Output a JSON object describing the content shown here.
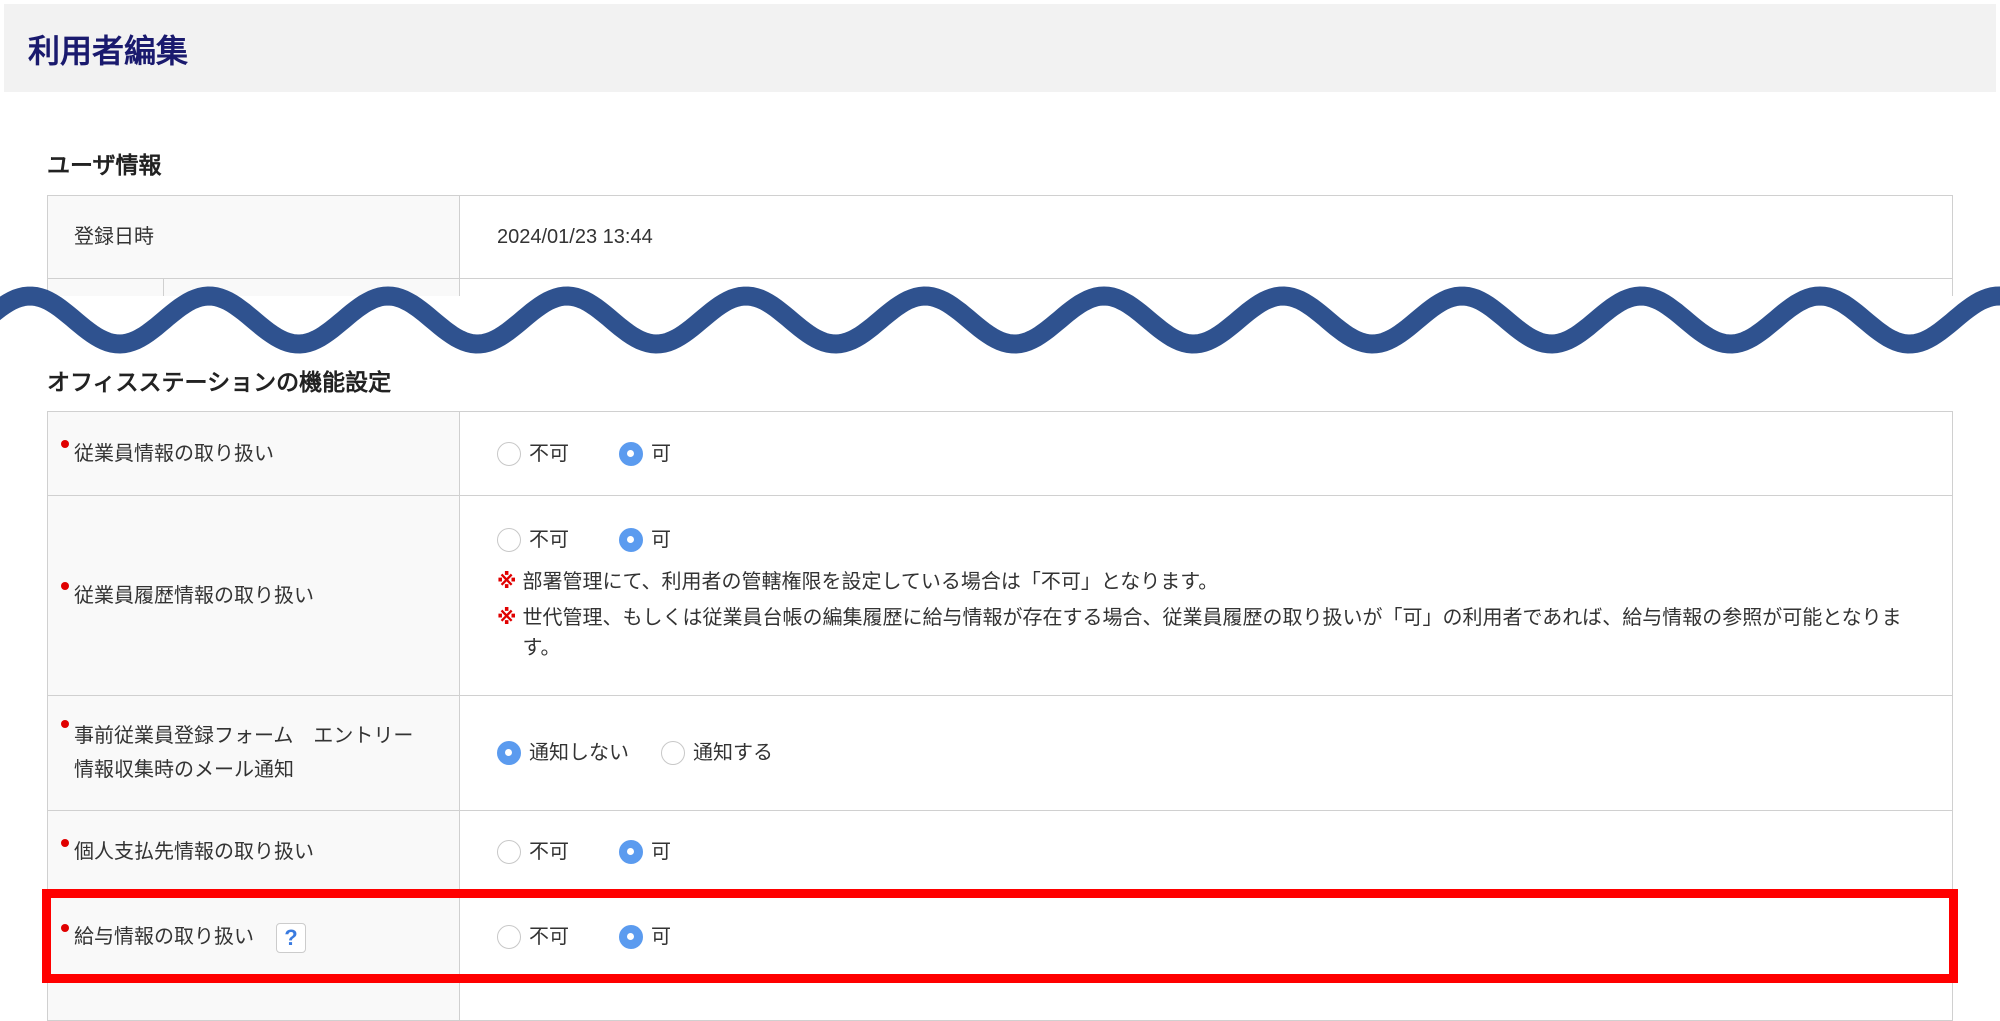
{
  "header": {
    "title": "利用者編集"
  },
  "user_info": {
    "heading": "ユーザ情報",
    "rows": [
      {
        "label": "登録日時",
        "value": "2024/01/23 13:44"
      }
    ]
  },
  "functions": {
    "heading": "オフィスステーションの機能設定",
    "rows": [
      {
        "label": "従業員情報の取り扱い",
        "options": [
          "不可",
          "可"
        ],
        "selected": "可"
      },
      {
        "label": "従業員履歴情報の取り扱い",
        "options": [
          "不可",
          "可"
        ],
        "selected": "可",
        "notes": [
          "部署管理にて、利用者の管轄権限を設定している場合は「不可」となります。",
          "世代管理、もしくは従業員台帳の編集履歴に給与情報が存在する場合、従業員履歴の取り扱いが「可」の利用者であれば、給与情報の参照が可能となります。"
        ],
        "note_mark": "※"
      },
      {
        "label": "事前従業員登録フォーム　エントリー情報収集時のメール通知",
        "options": [
          "通知しない",
          "通知する"
        ],
        "selected": "通知しない"
      },
      {
        "label": "個人支払先情報の取り扱い",
        "options": [
          "不可",
          "可"
        ],
        "selected": "可"
      },
      {
        "label": "給与情報の取り扱い",
        "help": "?",
        "options": [
          "不可",
          "可"
        ],
        "selected": "可"
      }
    ]
  },
  "colors": {
    "accent": "#5b9bef",
    "required": "#e00000",
    "highlight": "#ff0000",
    "wave": "#2f528f"
  }
}
